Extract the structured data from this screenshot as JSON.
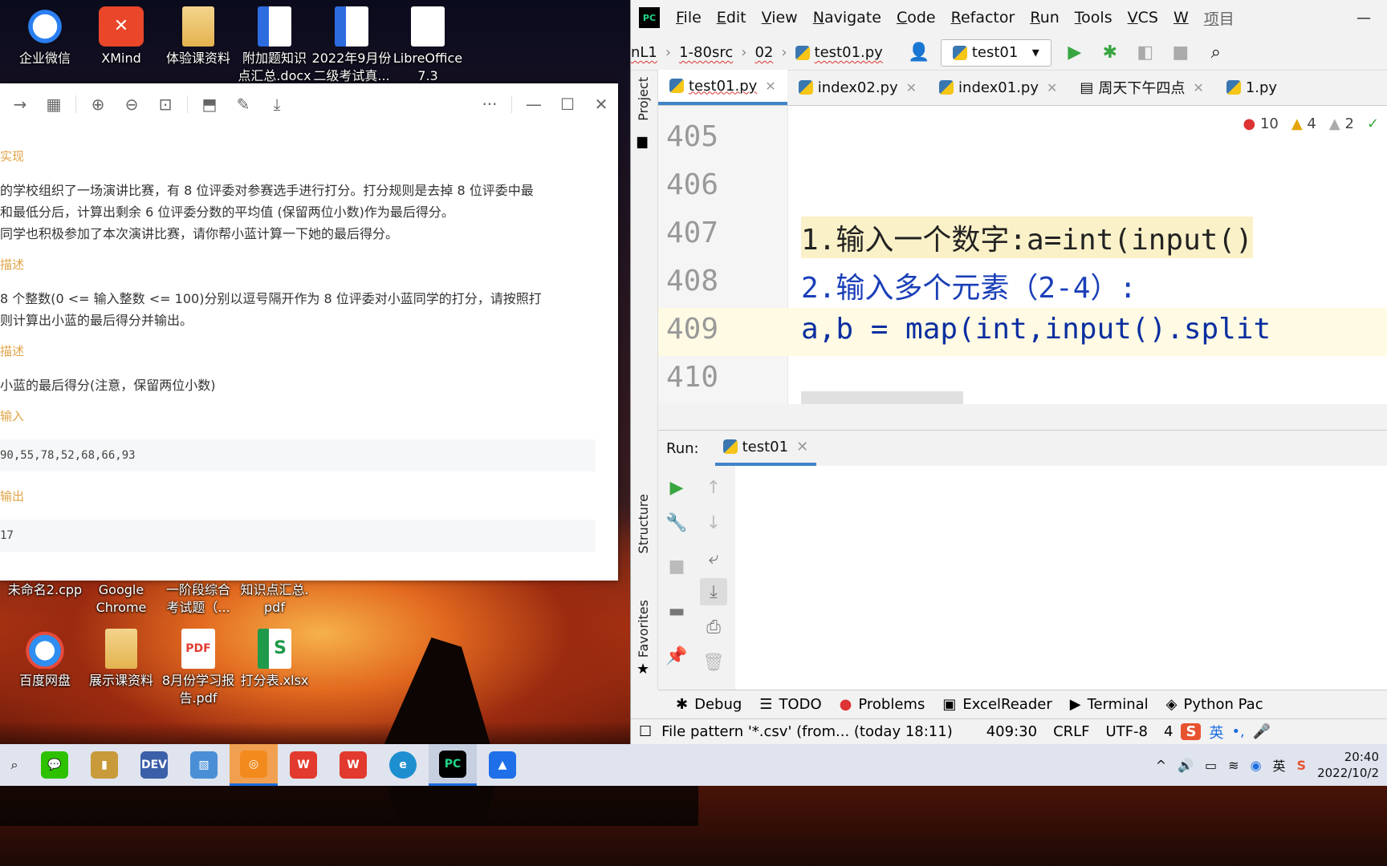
{
  "desktop": {
    "icons_top": [
      {
        "label": "企业微信",
        "icon": "wecom-icon"
      },
      {
        "label": "XMind",
        "icon": "xmind-icon"
      },
      {
        "label": "体验课资料",
        "icon": "folder-icon"
      },
      {
        "label": "附加题知识点汇总.docx",
        "line1": "附加题知识",
        "line2": "点汇总.docx",
        "icon": "word-doc-icon"
      },
      {
        "label": "2022年9月份二级考试真...",
        "line1": "2022年9月份",
        "line2": "二级考试真...",
        "icon": "word-doc-icon"
      },
      {
        "label": "LibreOffice 7.3",
        "line1": "LibreOffice",
        "line2": "7.3",
        "icon": "shortcut-icon"
      }
    ],
    "icons_mid": [
      {
        "line1": "未命名2.cpp",
        "line2": ""
      },
      {
        "line1": "Google",
        "line2": "Chrome"
      },
      {
        "line1": "一阶段综合",
        "line2": "考试题（..."
      },
      {
        "line1": "知识点汇总.",
        "line2": "pdf"
      }
    ],
    "icons_bottom": [
      {
        "line1": "百度网盘",
        "line2": "",
        "icon": "baidu-netdisk-icon"
      },
      {
        "line1": "展示课资料",
        "line2": "",
        "icon": "folder-icon"
      },
      {
        "line1": "8月份学习报",
        "line2": "告.pdf",
        "icon": "pdf-icon"
      },
      {
        "line1": "打分表.xlsx",
        "line2": "",
        "icon": "xlsx-icon"
      }
    ]
  },
  "viewer": {
    "sections": {
      "s1": "实现",
      "p1_l1": "的学校组织了一场演讲比赛，有 8 位评委对参赛选手进行打分。打分规则是去掉 8 位评委中最",
      "p1_l2": "和最低分后，计算出剩余 6 位评委分数的平均值 (保留两位小数)作为最后得分。",
      "p1_l3": "同学也积极参加了本次演讲比赛，请你帮小蓝计算一下她的最后得分。",
      "s2": "描述",
      "p2_l1": "8 个整数(0 <= 输入整数 <= 100)分别以逗号隔开作为 8 位评委对小蓝同学的打分，请按照打",
      "p2_l2": "则计算出小蓝的最后得分并输出。",
      "s3": "描述",
      "p3_l1": "小蓝的最后得分(注意，保留两位小数)",
      "s4": "输入",
      "input_sample": "90,55,78,52,68,66,93",
      "s5": "输出",
      "output_sample": "17"
    }
  },
  "ide": {
    "logo": "PC",
    "menu": [
      "File",
      "Edit",
      "View",
      "Navigate",
      "Code",
      "Refactor",
      "Run",
      "Tools",
      "VCS",
      "W",
      "项目"
    ],
    "breadcrumbs": [
      "nL1",
      "1-80src",
      "02",
      "test01.py"
    ],
    "run_config": "test01",
    "tabs": [
      "test01.py",
      "index02.py",
      "index01.py",
      "周天下午四点",
      "1.py"
    ],
    "side_labels": {
      "project": "Project",
      "structure": "Structure",
      "favorites": "Favorites"
    },
    "inspections": {
      "errors": "10",
      "warnings": "4",
      "weak": "2"
    },
    "lines": [
      {
        "no": "405",
        "code": ""
      },
      {
        "no": "406",
        "code": ""
      },
      {
        "no": "407",
        "code": "1.输入一个数字:a=int(input()"
      },
      {
        "no": "408",
        "code": "2.输入多个元素（2-4）:"
      },
      {
        "no": "409",
        "code": "a,b = map(int,input().split"
      },
      {
        "no": "410",
        "code": ""
      }
    ],
    "run_panel": {
      "label": "Run:",
      "tab": "test01"
    },
    "bottom_tools": [
      "Debug",
      "TODO",
      "Problems",
      "ExcelReader",
      "Terminal",
      "Python Pac"
    ],
    "status": {
      "message": "File pattern '*.csv' (from... (today 18:11)",
      "position": "409:30",
      "line_sep": "CRLF",
      "encoding": "UTF-8",
      "indent": "4"
    }
  },
  "taskbar": {
    "clock_time": "20:40",
    "clock_date": "2022/10/2",
    "ime": "英"
  }
}
